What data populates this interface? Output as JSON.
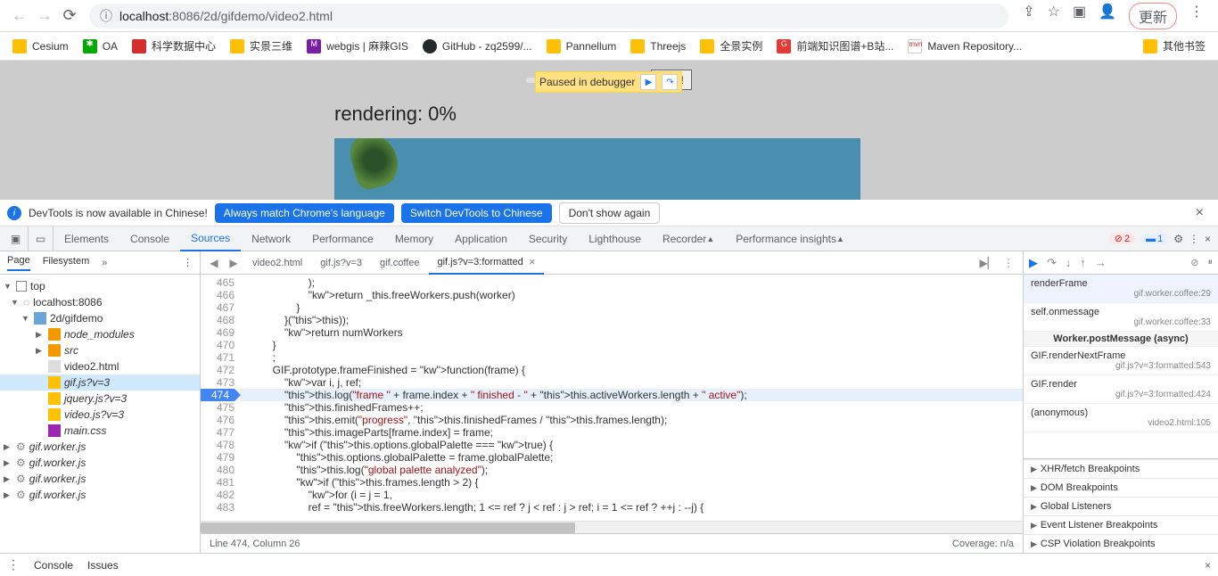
{
  "url": {
    "host": "localhost",
    "port": ":8086",
    "path": "/2d/gifdemo/video2.html"
  },
  "update_btn": "更新",
  "bookmarks": [
    {
      "label": "Cesium",
      "type": "folder"
    },
    {
      "label": "OA",
      "type": "green"
    },
    {
      "label": "科学数据中心",
      "type": "red"
    },
    {
      "label": "实景三维",
      "type": "folder"
    },
    {
      "label": "webgis | 麻辣GIS",
      "type": "purple"
    },
    {
      "label": "GitHub - zq2599/...",
      "type": "github"
    },
    {
      "label": "Pannellum",
      "type": "folder"
    },
    {
      "label": "Threejs",
      "type": "folder"
    },
    {
      "label": "全景实例",
      "type": "folder"
    },
    {
      "label": "前端知识图谱+B站...",
      "type": "redg"
    },
    {
      "label": "Maven Repository...",
      "type": "mvn"
    },
    {
      "label": "其他书签",
      "type": "folder"
    }
  ],
  "page": {
    "exec_btn": "执行!",
    "paused": "Paused in debugger",
    "rendering": "rendering: 0%"
  },
  "banner": {
    "text": "DevTools is now available in Chinese!",
    "b1": "Always match Chrome's language",
    "b2": "Switch DevTools to Chinese",
    "b3": "Don't show again"
  },
  "tabs": [
    "Elements",
    "Console",
    "Sources",
    "Network",
    "Performance",
    "Memory",
    "Application",
    "Security",
    "Lighthouse",
    "Recorder",
    "Performance insights"
  ],
  "active_tab": "Sources",
  "errors": "2",
  "issues": "1",
  "left_tabs": [
    "Page",
    "Filesystem"
  ],
  "tree": {
    "top": "top",
    "host": "localhost:8086",
    "path": "2d/gifdemo",
    "nm": "node_modules",
    "src": "src",
    "files": [
      "video2.html",
      "gif.js?v=3",
      "jquery.js?v=3",
      "video.js?v=3",
      "main.css"
    ],
    "workers": [
      "gif.worker.js",
      "gif.worker.js",
      "gif.worker.js",
      "gif.worker.js"
    ]
  },
  "code_tabs": [
    "video2.html",
    "gif.js?v=3",
    "gif.coffee",
    "gif.js?v=3:formatted"
  ],
  "active_code_tab": 3,
  "code": {
    "start": 465,
    "lines": [
      "                    );",
      "                    return _this.freeWorkers.push(worker)",
      "                }",
      "            }(this));",
      "            return numWorkers",
      "        }",
      "        ;",
      "        GIF.prototype.frameFinished = function(frame) {",
      "            var i, j, ref;",
      "            this.log(\"frame \" + frame.index + \" finished - \" + this.activeWorkers.length + \" active\");",
      "            this.finishedFrames++;",
      "            this.emit(\"progress\", this.finishedFrames / this.frames.length);",
      "            this.imageParts[frame.index] = frame;",
      "            if (this.options.globalPalette === true) {",
      "                this.options.globalPalette = frame.globalPalette;",
      "                this.log(\"global palette analyzed\");",
      "                if (this.frames.length > 2) {",
      "                    for (i = j = 1,",
      "                    ref = this.freeWorkers.length; 1 <= ref ? j < ref : j > ref; i = 1 <= ref ? ++j : --j) {"
    ],
    "bp_line": 474
  },
  "status": {
    "left": "Line 474, Column 26",
    "right": "Coverage: n/a"
  },
  "callstack": [
    {
      "name": "renderFrame",
      "loc": "gif.worker.coffee:29"
    },
    {
      "name": "self.onmessage",
      "loc": "gif.worker.coffee:33"
    },
    {
      "name": "Worker.postMessage (async)",
      "async": true
    },
    {
      "name": "GIF.renderNextFrame",
      "loc": "gif.js?v=3:formatted:543"
    },
    {
      "name": "GIF.render",
      "loc": "gif.js?v=3:formatted:424"
    },
    {
      "name": "(anonymous)",
      "loc": "video2.html:105"
    }
  ],
  "bp_sections": [
    "XHR/fetch Breakpoints",
    "DOM Breakpoints",
    "Global Listeners",
    "Event Listener Breakpoints",
    "CSP Violation Breakpoints"
  ],
  "drawer": [
    "Console",
    "Issues"
  ]
}
